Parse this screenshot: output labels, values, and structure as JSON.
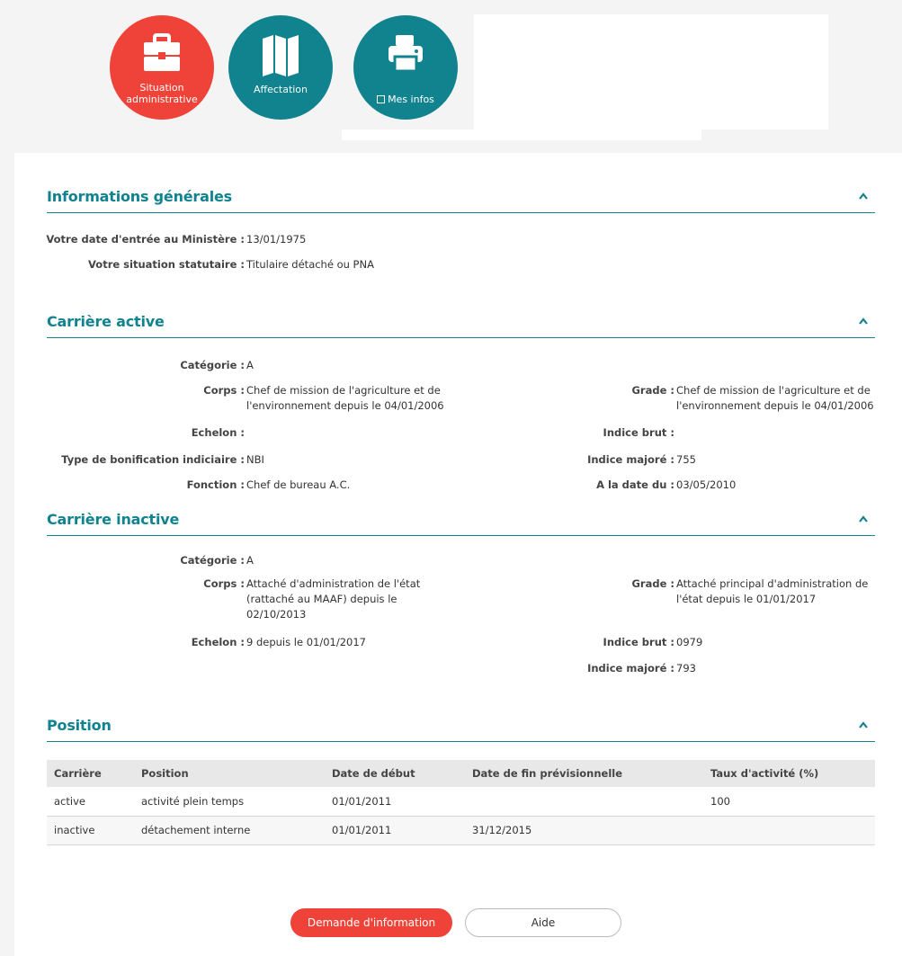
{
  "nav": [
    {
      "label": "Situation administrative",
      "icon": "briefcase-icon",
      "color": "#ef4238"
    },
    {
      "label": "Affectation",
      "icon": "map-icon",
      "color": "#10838f"
    },
    {
      "label": "Mes infos",
      "icon": "printer-icon",
      "sub_icon": "document-icon",
      "color": "#10838f"
    }
  ],
  "sections": {
    "general": {
      "title": "Informations générales",
      "fields": [
        {
          "label": "Votre date d'entrée au Ministère :",
          "value": "13/01/1975"
        },
        {
          "label": "Votre situation statutaire :",
          "value": "Titulaire détaché ou PNA"
        }
      ]
    },
    "active": {
      "title": "Carrière active",
      "left": [
        {
          "label": "Catégorie :",
          "value": "A"
        },
        {
          "label": "Corps :",
          "value": "Chef de mission de l'agriculture et de l'environnement depuis le 04/01/2006"
        },
        {
          "label": "Echelon :",
          "value": ""
        },
        {
          "label": "Type de bonification indiciaire :",
          "value": "NBI"
        },
        {
          "label": "Fonction :",
          "value": "Chef de bureau A.C."
        }
      ],
      "right": [
        {
          "label": "Grade :",
          "value": "Chef de mission de l'agriculture et de l'environnement depuis le 04/01/2006"
        },
        {
          "label": "Indice brut :",
          "value": ""
        },
        {
          "label": "Indice majoré :",
          "value": "755"
        },
        {
          "label": "A la date du :",
          "value": "03/05/2010"
        }
      ]
    },
    "inactive": {
      "title": "Carrière inactive",
      "left": [
        {
          "label": "Catégorie :",
          "value": "A"
        },
        {
          "label": "Corps :",
          "value": "Attaché d'administration de l'état (rattaché au MAAF) depuis le 02/10/2013"
        },
        {
          "label": "Echelon :",
          "value": "9 depuis le 01/01/2017"
        }
      ],
      "right": [
        {
          "label": "Grade :",
          "value": "Attaché principal d'administration de l'état depuis le 01/01/2017"
        },
        {
          "label": "Indice brut :",
          "value": "0979"
        },
        {
          "label": "Indice majoré :",
          "value": "793"
        }
      ]
    },
    "position": {
      "title": "Position",
      "columns": [
        "Carrière",
        "Position",
        "Date de début",
        "Date de fin prévisionnelle",
        "Taux d'activité (%)"
      ],
      "rows": [
        [
          "active",
          "activité plein temps",
          "01/01/2011",
          "",
          "100"
        ],
        [
          "inactive",
          "détachement interne",
          "01/01/2011",
          "31/12/2015",
          ""
        ]
      ]
    }
  },
  "buttons": {
    "request": "Demande d'information",
    "help": "Aide"
  },
  "colors": {
    "accent": "#10838f",
    "primary_red": "#ef4238"
  }
}
